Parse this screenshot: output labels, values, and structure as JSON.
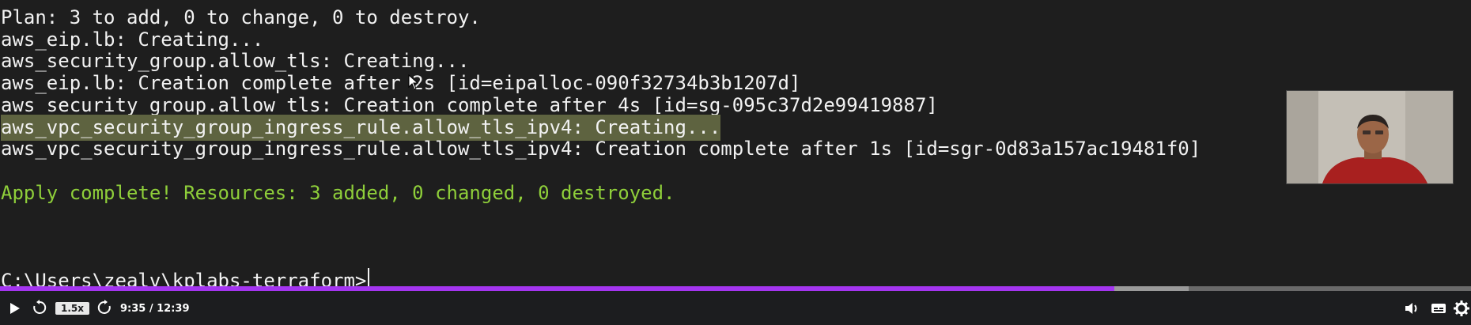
{
  "terminal": {
    "lines": [
      "Plan: 3 to add, 0 to change, 0 to destroy.",
      "aws_eip.lb: Creating...",
      "aws_security_group.allow_tls: Creating...",
      "aws_eip.lb: Creation complete after 2s [id=eipalloc-090f32734b3b1207d]",
      "aws_security_group.allow_tls: Creation complete after 4s [id=sg-095c37d2e99419887]",
      "aws_vpc_security_group_ingress_rule.allow_tls_ipv4: Creating...",
      "aws_vpc_security_group_ingress_rule.allow_tls_ipv4: Creation complete after 1s [id=sgr-0d83a157ac19481f0]",
      "Apply complete! Resources: 3 added, 0 changed, 0 destroyed.",
      "C:\\Users\\zealv\\kplabs-terraform>"
    ]
  },
  "player": {
    "speed": "1.5x",
    "time": "9:35 / 12:39",
    "progress_fraction": 0.7576,
    "buffered_fraction": 0.808,
    "accent_color": "#a435f0"
  },
  "icons": {
    "play": "play-icon",
    "rewind": "rewind-5-icon",
    "forward": "forward-5-icon",
    "volume": "volume-icon",
    "captions": "captions-icon",
    "settings": "gear-icon"
  }
}
